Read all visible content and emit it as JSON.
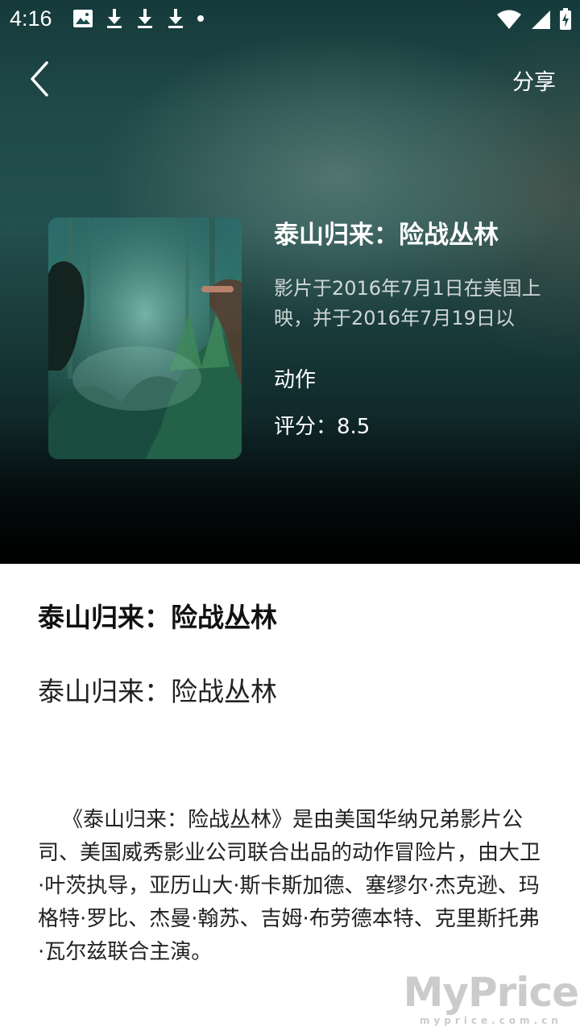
{
  "status_bar": {
    "time": "4:16"
  },
  "toolbar": {
    "share_label": "分享"
  },
  "movie": {
    "title": "泰山归来：险战丛林",
    "description": "影片于2016年7月1日在美国上映，并于2016年7月19日以",
    "genre": "动作",
    "rating_label": "评分：8.5"
  },
  "detail": {
    "title": "泰山归来：险战丛林",
    "subtitle": "泰山归来：险战丛林",
    "body": "《泰山归来：险战丛林》是由美国华纳兄弟影片公司、美国威秀影业公司联合出品的动作冒险片，由大卫·叶茨执导，亚历山大·斯卡斯加德、塞缪尔·杰克逊、玛格特·罗比、杰曼·翰苏、吉姆·布劳德本特、克里斯托弗·瓦尔兹联合主演。"
  },
  "watermark": {
    "main": "MyPrice",
    "sub": "myprice.com.cn"
  }
}
